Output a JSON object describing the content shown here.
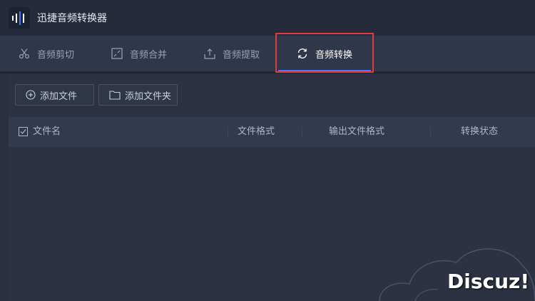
{
  "app": {
    "title": "迅捷音频转换器"
  },
  "tabs": [
    {
      "label": "音频剪切",
      "icon": "scissors-icon",
      "active": false
    },
    {
      "label": "音频合并",
      "icon": "merge-icon",
      "active": false
    },
    {
      "label": "音频提取",
      "icon": "extract-icon",
      "active": false
    },
    {
      "label": "音频转换",
      "icon": "convert-icon",
      "active": true
    }
  ],
  "toolbar": {
    "add_file_label": "添加文件",
    "add_folder_label": "添加文件夹"
  },
  "table": {
    "columns": [
      "文件名",
      "文件格式",
      "输出文件格式",
      "转换状态"
    ],
    "rows": []
  },
  "watermark": "Discuz!",
  "colors": {
    "accent": "#4b74ff",
    "highlight": "#e03a3a",
    "background": "#2a3042"
  }
}
